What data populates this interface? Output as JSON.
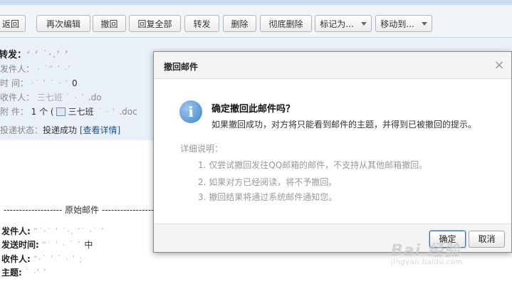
{
  "toolbar": {
    "buttons": {
      "back": "返回",
      "reedit": "再次编辑",
      "recall": "撤回",
      "reply_all": "回复全部",
      "forward": "转发",
      "delete": "删除",
      "delete_permanent": "彻底删除",
      "mark_as": "标记为...",
      "move_to": "移动到..."
    }
  },
  "mail_header": {
    "subject_label": "转发：",
    "rows": {
      "sender_label": "发件人：",
      "time_label": "时  间：",
      "recipient_label": "收件人：",
      "recipient_value": "三七班",
      "attachment_label": "附  件：",
      "attachment_value": "1 个 (",
      "attachment_name": "三七班",
      "doc_ext": ".doc",
      "doc_ext_short": ".do",
      "digit_zero": "0"
    },
    "status_label": "投递状态：",
    "status_value": "投递成功",
    "status_link": "[查看详情]"
  },
  "original_mail": {
    "separator": "------------------- 原始邮件 -------------------",
    "sender_label": "发件人:",
    "time_label": "发送时间:",
    "recipient_label": "收件人:",
    "subject_label": "主题:",
    "tail_char": "中"
  },
  "dialog": {
    "title": "撤回邮件",
    "close_symbol": "×",
    "heading": "确定撤回此邮件吗？",
    "description": "如果撤回成功，对方将只能看到邮件的主题，并得到已被撤回的提示。",
    "detail_title": "详细说明：",
    "details": [
      "1. 仅尝试撤回发往QQ邮箱的邮件，不支持从其他邮箱撤回。",
      "2. 如果对方已经阅读，将不予撤回。",
      "3. 撤回结果将通过系统邮件通知您。"
    ],
    "confirm_label": "确定",
    "cancel_label": "取消"
  },
  "icons": {
    "info": "info-icon",
    "close": "close-icon",
    "attachment": "document-icon",
    "dropdown": "chevron-down-icon"
  },
  "watermark": {
    "main": "Bai 经验",
    "sub": "jingyan.baidu.com"
  },
  "colors": {
    "toolbar_bg": "#f1f5fa",
    "header_bg": "#eaf0f8",
    "link": "#1e5494",
    "info_icon": "#3f82c9"
  }
}
